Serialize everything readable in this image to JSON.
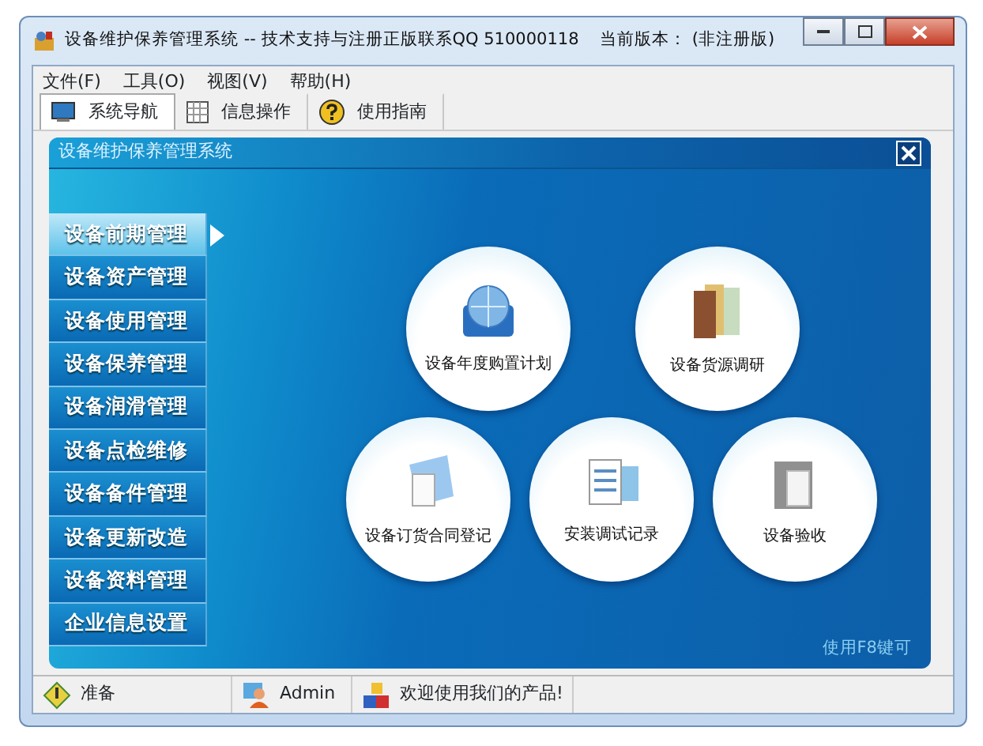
{
  "window": {
    "title": "设备维护保养管理系统 -- 技术支持与注册正版联系QQ 510000118    当前版本： (非注册版)"
  },
  "menu": [
    "文件(F)",
    "工具(O)",
    "视图(V)",
    "帮助(H)"
  ],
  "toolbar": [
    {
      "label": "系统导航",
      "selected": true
    },
    {
      "label": "信息操作",
      "selected": false
    },
    {
      "label": "使用指南",
      "selected": false
    }
  ],
  "panel": {
    "title": "设备维护保养管理系统",
    "hint": "使用F8键可"
  },
  "nav": [
    {
      "label": "设备前期管理",
      "selected": true
    },
    {
      "label": "设备资产管理",
      "selected": false
    },
    {
      "label": "设备使用管理",
      "selected": false
    },
    {
      "label": "设备保养管理",
      "selected": false
    },
    {
      "label": "设备润滑管理",
      "selected": false
    },
    {
      "label": "设备点检维修",
      "selected": false
    },
    {
      "label": "设备备件管理",
      "selected": false
    },
    {
      "label": "设备更新改造",
      "selected": false
    },
    {
      "label": "设备资料管理",
      "selected": false
    },
    {
      "label": "企业信息设置",
      "selected": false
    }
  ],
  "tiles": [
    [
      "设备年度购置计划",
      "设备货源调研"
    ],
    [
      "设备订货合同登记",
      "安装调试记录",
      "设备验收"
    ]
  ],
  "status_bar": [
    "准备",
    "Admin",
    "欢迎使用我们的产品!"
  ]
}
